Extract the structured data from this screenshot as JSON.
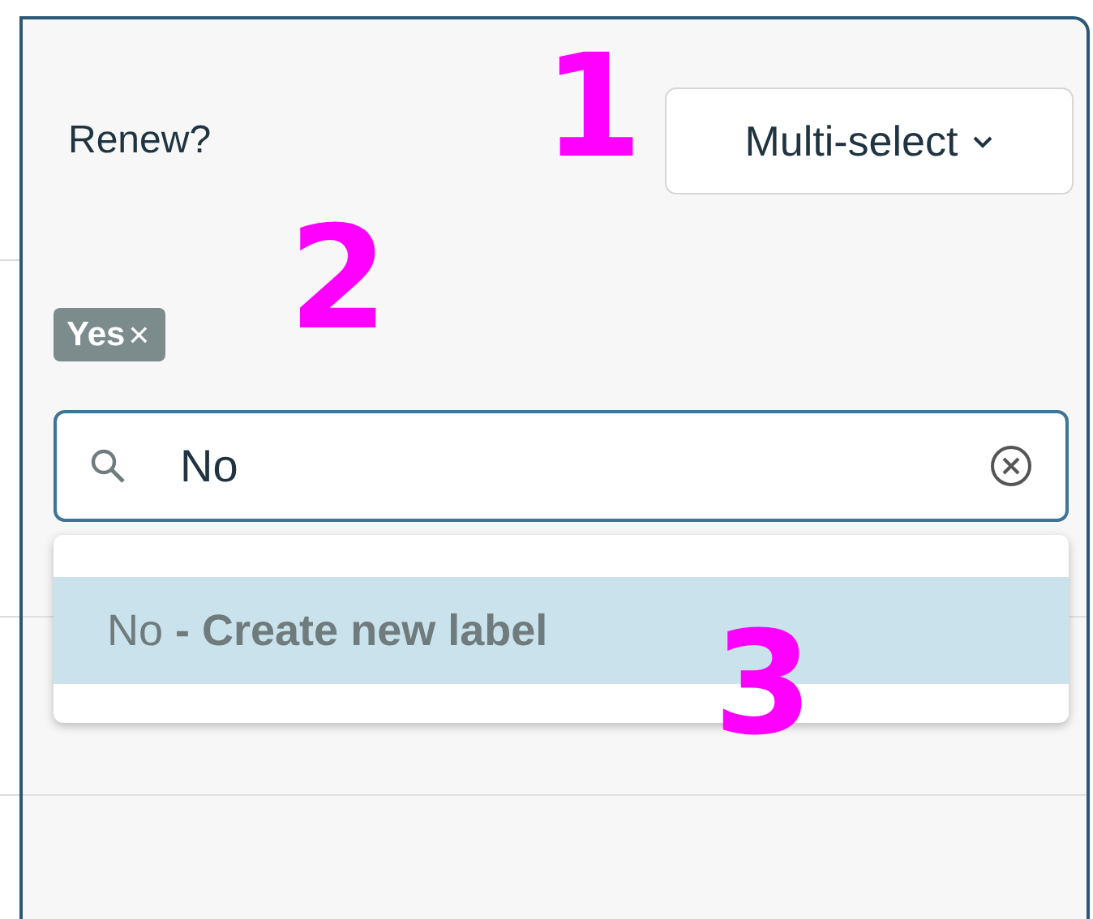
{
  "field": {
    "label": "Renew?"
  },
  "mode_button": {
    "label": "Multi-select"
  },
  "tags": [
    {
      "label": "Yes",
      "remove": "×"
    }
  ],
  "search": {
    "value": "No"
  },
  "dropdown": {
    "options": [
      {
        "text": "No **- Create new label**",
        "selected": true
      }
    ]
  },
  "callouts": [
    {
      "text": "1"
    },
    {
      "text": "2"
    },
    {
      "text": "3"
    }
  ]
}
